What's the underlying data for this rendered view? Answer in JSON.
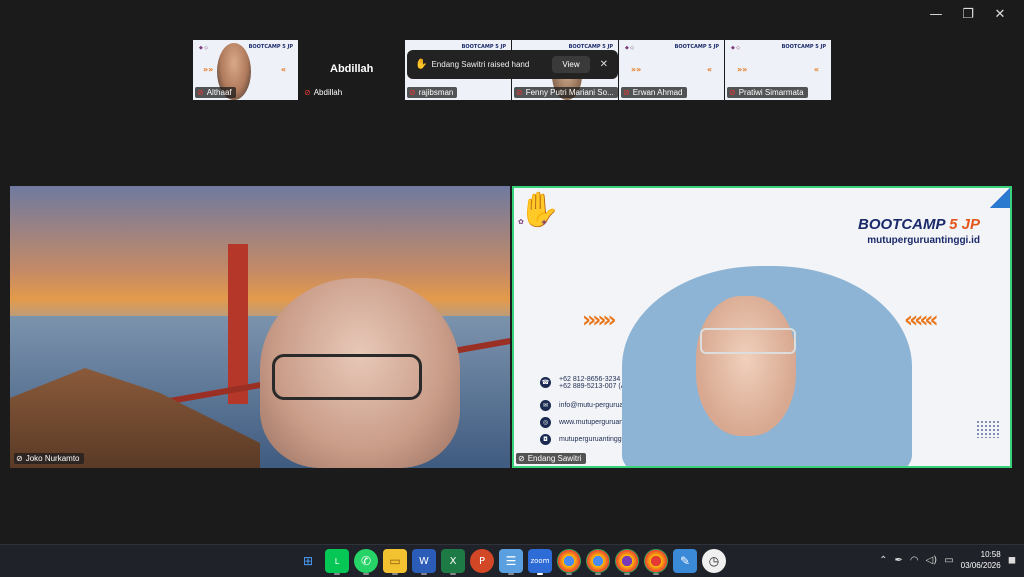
{
  "window": {
    "controls": [
      "—",
      "❐",
      "✕"
    ]
  },
  "thumbnails": [
    {
      "name": "Althaaf"
    },
    {
      "name": "Abdillah",
      "big_name": "Abdillah"
    },
    {
      "name": "rajibsman"
    },
    {
      "name": "Fenny Putri Mariani So..."
    },
    {
      "name": "Erwan Ahmad"
    },
    {
      "name": "Pratiwi Simarmata"
    }
  ],
  "thumb_brand": "BOOTCAMP 5 JP",
  "thumb_arrows": "»»",
  "notification": {
    "text": "Endang Sawitri raised hand",
    "button": "View"
  },
  "main": {
    "left": {
      "name": "Joko Nurkamto"
    },
    "right": {
      "name": "Endang Sawitri",
      "brand_title": "BOOTCAMP",
      "brand_num": "5 JP",
      "brand_url": "mutuperguruantinggi.id",
      "arrows_right": "»»»",
      "arrows_left": "«««",
      "contacts": {
        "phone1": "+62 812-8656-3234 (Rossi)",
        "phone2": "+62 889-5213-007 (Althaaf)",
        "email": "info@mutu-perguruantinggi.id",
        "web": "www.mutuperguruantinggi.id",
        "ig": "mutuperguruantinggi.id"
      }
    }
  },
  "taskbar": {
    "apps": [
      "windows-start",
      "line",
      "whatsapp",
      "file-explorer",
      "word",
      "excel",
      "powerpoint",
      "notepad",
      "zoom",
      "chrome",
      "chrome-profile-2",
      "chrome-profile-3",
      "chrome-profile-4",
      "snipping",
      "clock-app"
    ],
    "clock": {
      "time": "10:58",
      "date": "03/06/2026"
    }
  }
}
